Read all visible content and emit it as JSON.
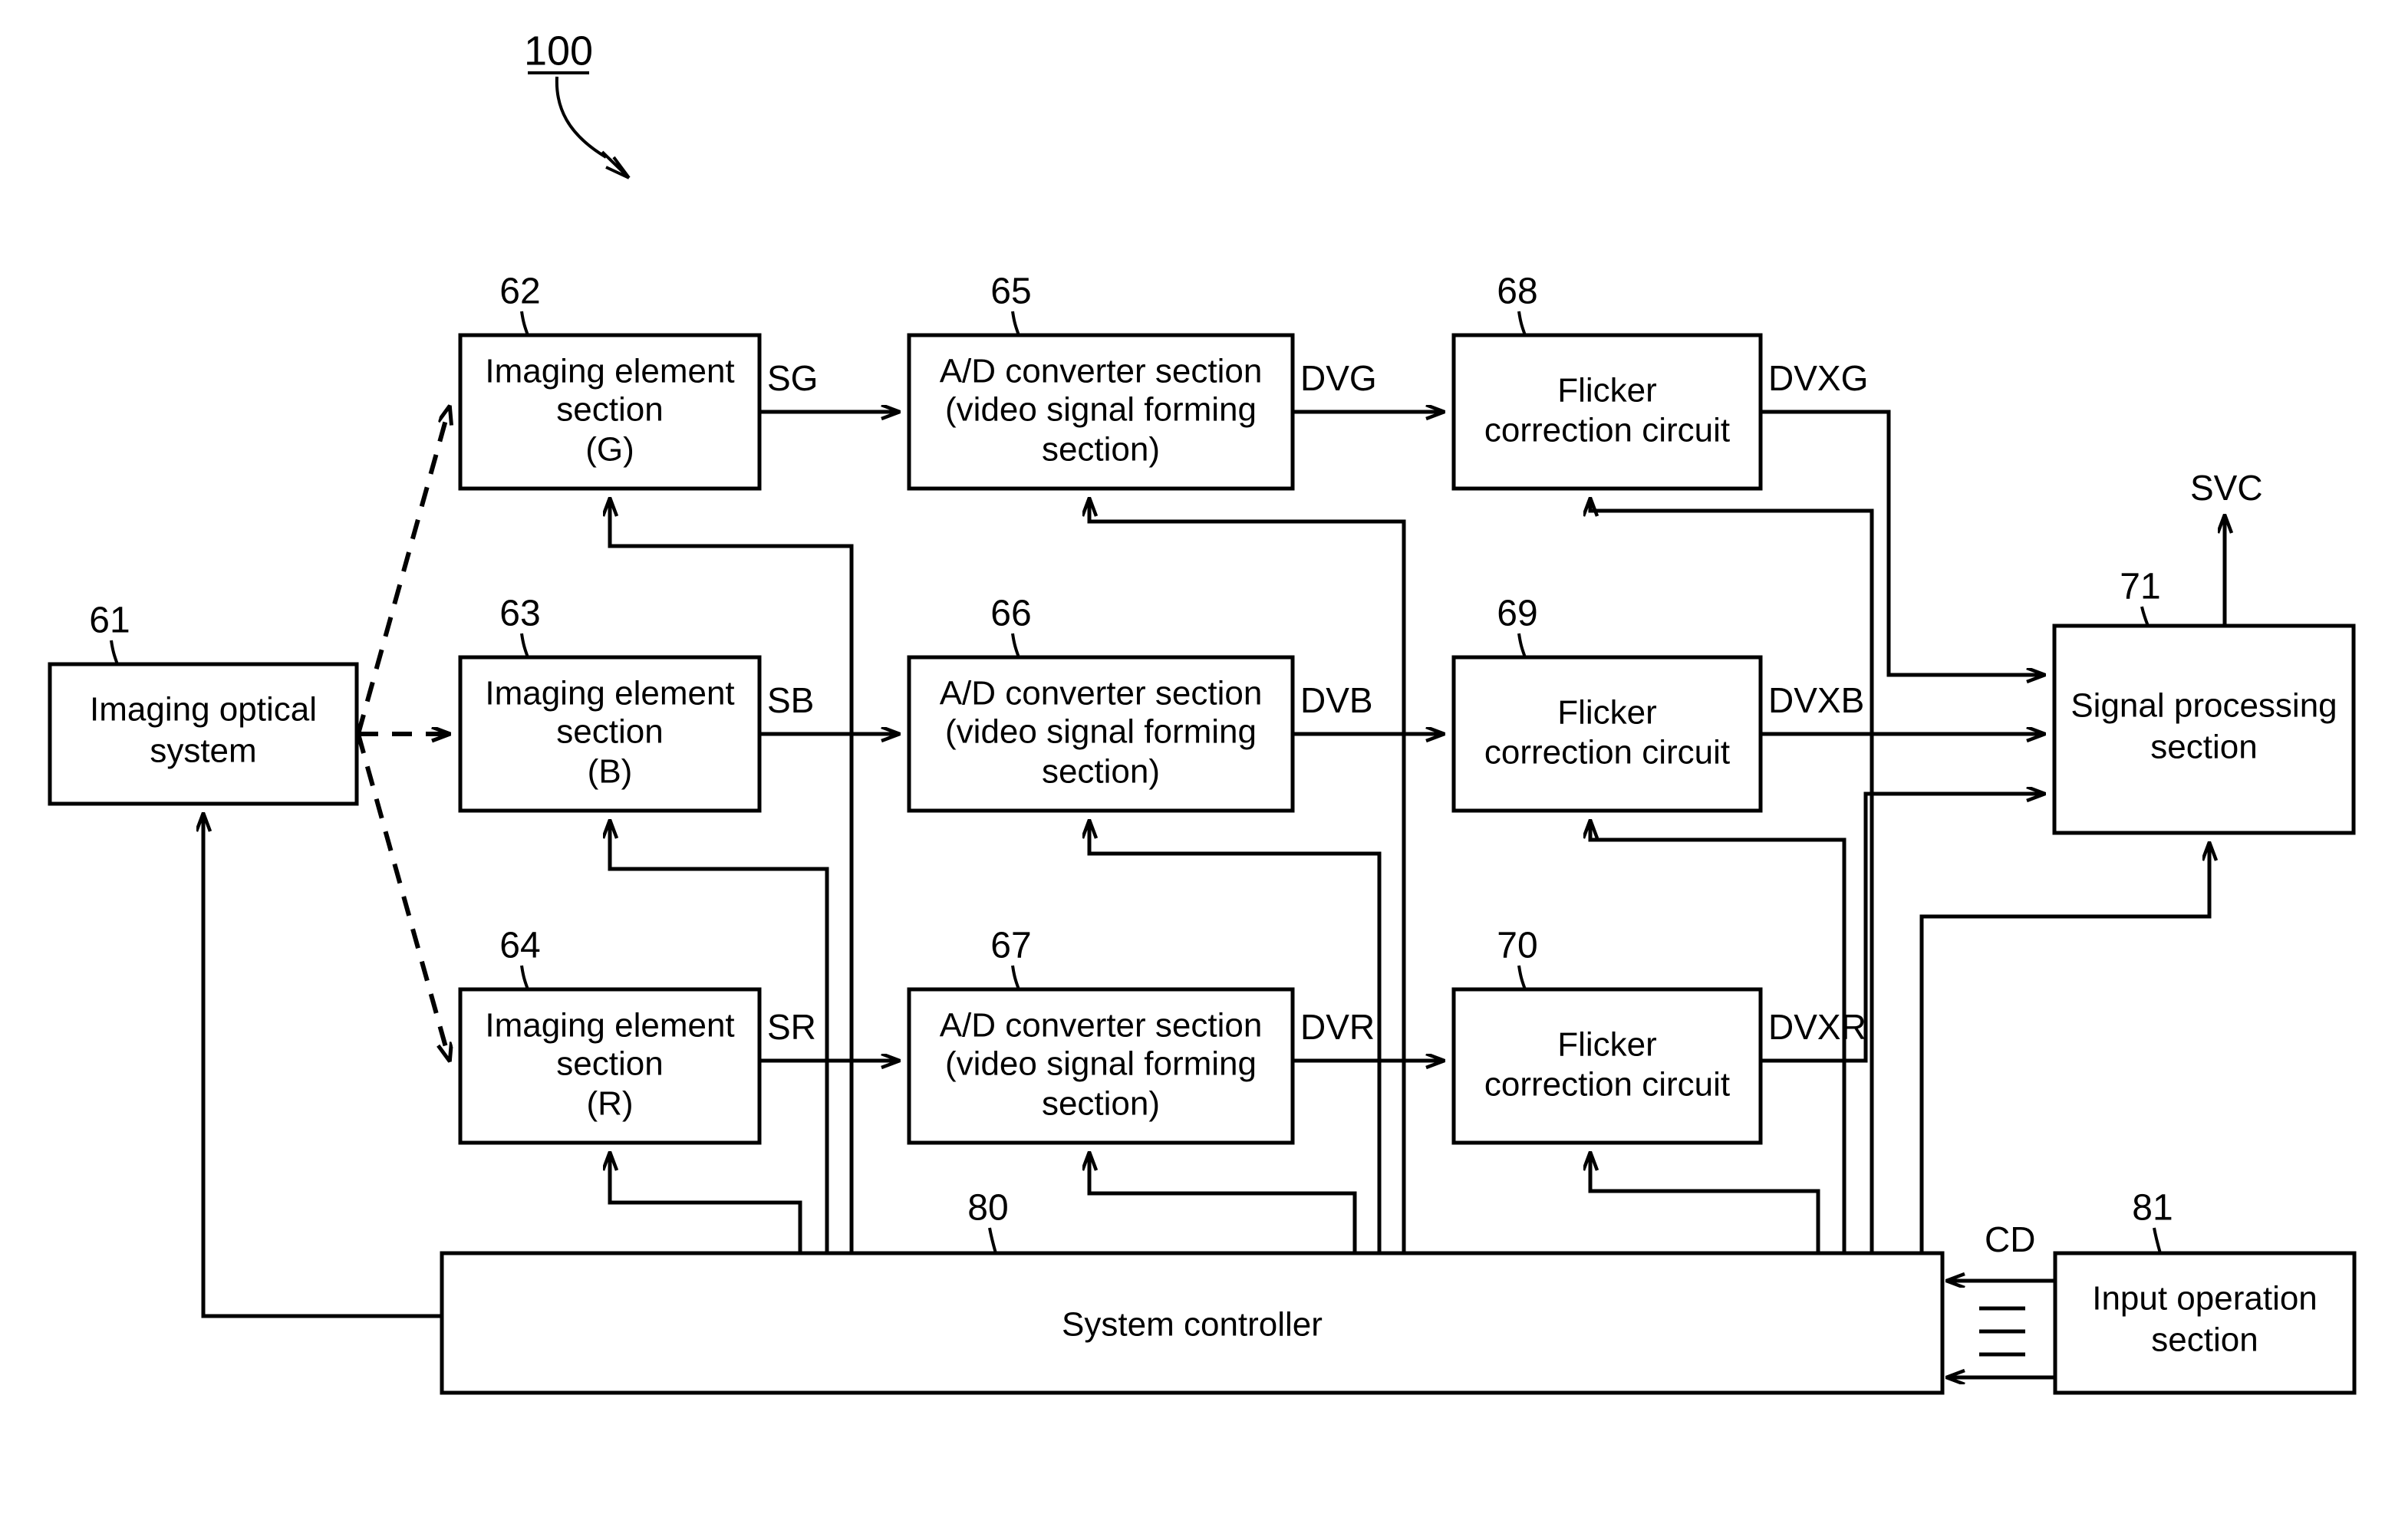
{
  "figure": {
    "number": "100",
    "title_underline": true
  },
  "blocks": [
    {
      "id": "imaging-optical-system",
      "ref": "61",
      "lines": [
        "Imaging optical",
        "system"
      ]
    },
    {
      "id": "imaging-element-g",
      "ref": "62",
      "lines": [
        "Imaging element",
        "section",
        "(G)"
      ]
    },
    {
      "id": "imaging-element-b",
      "ref": "63",
      "lines": [
        "Imaging element",
        "section",
        "(B)"
      ]
    },
    {
      "id": "imaging-element-r",
      "ref": "64",
      "lines": [
        "Imaging element",
        "section",
        "(R)"
      ]
    },
    {
      "id": "ad-converter-g",
      "ref": "65",
      "lines": [
        "A/D converter section",
        "(video signal forming",
        "section)"
      ]
    },
    {
      "id": "ad-converter-b",
      "ref": "66",
      "lines": [
        "A/D converter section",
        "(video signal forming",
        "section)"
      ]
    },
    {
      "id": "ad-converter-r",
      "ref": "67",
      "lines": [
        "A/D converter section",
        "(video signal forming",
        "section)"
      ]
    },
    {
      "id": "flicker-correction-g",
      "ref": "68",
      "lines": [
        "Flicker",
        "correction circuit"
      ]
    },
    {
      "id": "flicker-correction-b",
      "ref": "69",
      "lines": [
        "Flicker",
        "correction circuit"
      ]
    },
    {
      "id": "flicker-correction-r",
      "ref": "70",
      "lines": [
        "Flicker",
        "correction circuit"
      ]
    },
    {
      "id": "signal-processing",
      "ref": "71",
      "lines": [
        "Signal processing",
        "section"
      ]
    },
    {
      "id": "system-controller",
      "ref": "80",
      "lines": [
        "System controller"
      ]
    },
    {
      "id": "input-operation",
      "ref": "81",
      "lines": [
        "Input operation",
        "section"
      ]
    }
  ],
  "signals": {
    "sg": "SG",
    "sb": "SB",
    "sr": "SR",
    "dvg": "DVG",
    "dvb": "DVB",
    "dvr": "DVR",
    "dvxg": "DVXG",
    "dvxb": "DVXB",
    "dvxr": "DVXR",
    "svc": "SVC",
    "cd": "CD"
  },
  "colors": {
    "stroke": "#000000",
    "background": "#ffffff"
  }
}
